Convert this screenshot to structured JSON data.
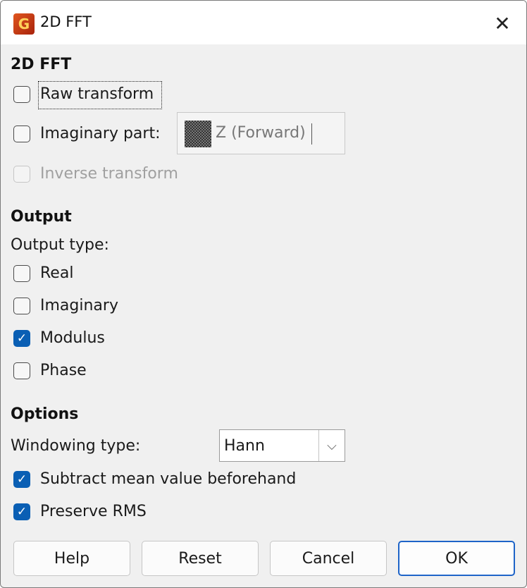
{
  "window": {
    "title": "2D FFT",
    "close_glyph": "✕",
    "icon": "app-logo-icon"
  },
  "fft_section": {
    "heading": "2D FFT",
    "raw_transform": {
      "label": "Raw transform",
      "checked": false
    },
    "imaginary_part": {
      "label": "Imaginary part:",
      "checked": false,
      "field_value": "Z (Forward)"
    },
    "inverse_transform": {
      "label": "Inverse transform",
      "checked": false,
      "disabled": true
    }
  },
  "output_section": {
    "heading": "Output",
    "type_label": "Output type:",
    "options": [
      {
        "label": "Real",
        "checked": false
      },
      {
        "label": "Imaginary",
        "checked": false
      },
      {
        "label": "Modulus",
        "checked": true
      },
      {
        "label": "Phase",
        "checked": false
      }
    ]
  },
  "options_section": {
    "heading": "Options",
    "windowing_label": "Windowing type:",
    "windowing_value": "Hann",
    "subtract_mean": {
      "label": "Subtract mean value beforehand",
      "checked": true
    },
    "preserve_rms": {
      "label": "Preserve RMS",
      "checked": true
    }
  },
  "buttons": {
    "help": "Help",
    "reset": "Reset",
    "cancel": "Cancel",
    "ok": "OK"
  },
  "colors": {
    "accent": "#0a5fb4",
    "dialog_bg": "#f0f0f0",
    "primary_border": "#1e64c8"
  }
}
